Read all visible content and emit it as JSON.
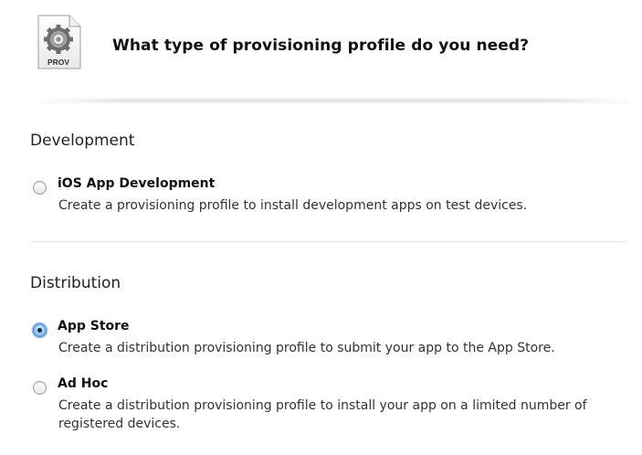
{
  "header": {
    "icon_label": "PROV",
    "title": "What type of provisioning profile do you need?"
  },
  "development": {
    "title": "Development",
    "options": [
      {
        "label": "iOS App Development",
        "description": "Create a provisioning profile to install development apps on test devices.",
        "selected": false
      }
    ]
  },
  "distribution": {
    "title": "Distribution",
    "options": [
      {
        "label": "App Store",
        "description": "Create a distribution provisioning profile to submit your app to the App Store.",
        "selected": true
      },
      {
        "label": "Ad Hoc",
        "description": "Create a distribution provisioning profile to install your app on a limited number of registered devices.",
        "selected": false
      }
    ]
  },
  "colors": {
    "radio_selected": "#5d9ad8",
    "text": "#1a1a1a"
  }
}
